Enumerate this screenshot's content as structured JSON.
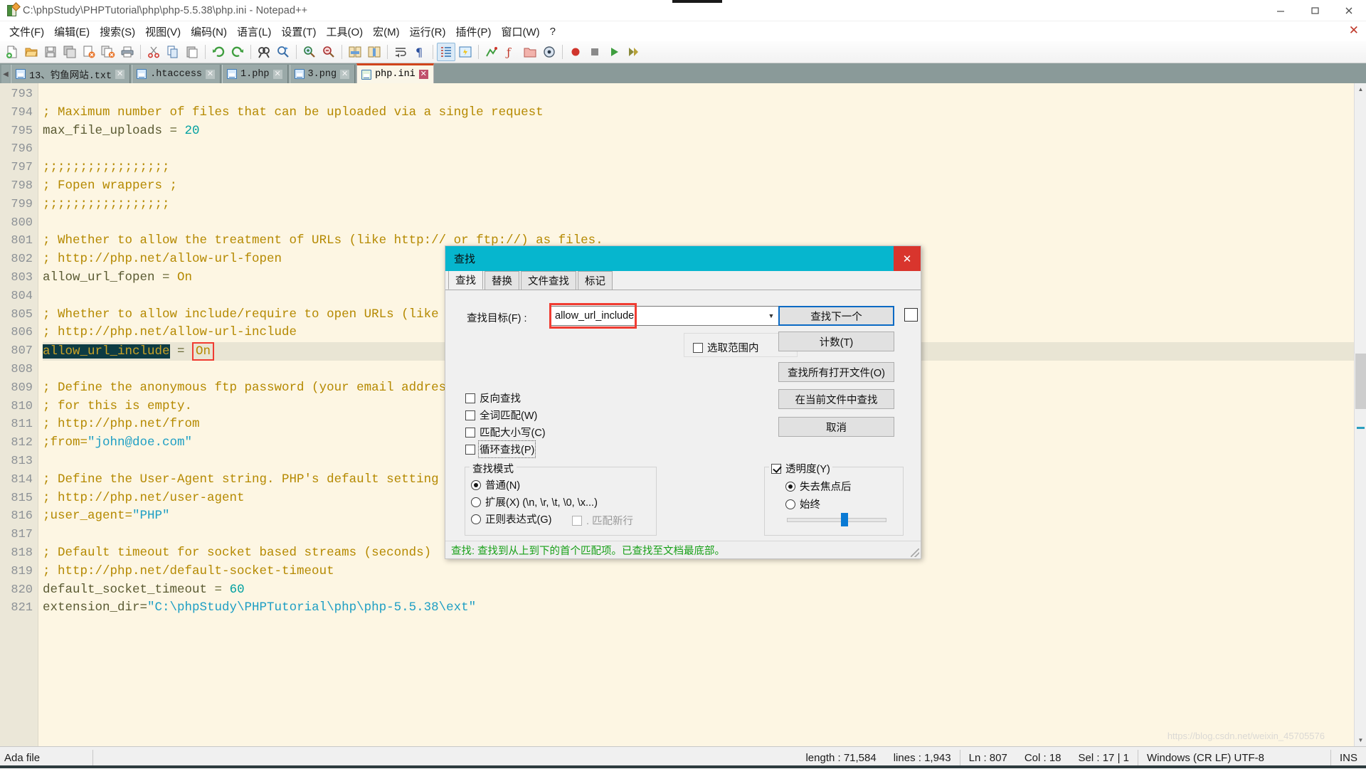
{
  "window": {
    "title": "C:\\phpStudy\\PHPTutorial\\php\\php-5.5.38\\php.ini - Notepad++",
    "icon": "notepad-plus-plus-icon",
    "minimize": "─",
    "maximize": "□",
    "close": "✕"
  },
  "menubar": {
    "items": [
      {
        "label": "文件(F)"
      },
      {
        "label": "编辑(E)"
      },
      {
        "label": "搜索(S)"
      },
      {
        "label": "视图(V)"
      },
      {
        "label": "编码(N)"
      },
      {
        "label": "语言(L)"
      },
      {
        "label": "设置(T)"
      },
      {
        "label": "工具(O)"
      },
      {
        "label": "宏(M)"
      },
      {
        "label": "运行(R)"
      },
      {
        "label": "插件(P)"
      },
      {
        "label": "窗口(W)"
      },
      {
        "label": "?"
      }
    ],
    "close_document": "✕"
  },
  "toolbar": {
    "buttons": [
      "new-file-icon",
      "open-file-icon",
      "save-icon",
      "save-all-icon",
      "close-file-icon",
      "close-all-icon",
      "print-icon",
      "cut-icon",
      "copy-icon",
      "paste-icon",
      "undo-icon",
      "redo-icon",
      "find-icon",
      "replace-icon",
      "zoom-in-icon",
      "zoom-out-icon",
      "sync-scroll-v-icon",
      "sync-scroll-h-icon",
      "word-wrap-icon",
      "show-all-chars-icon",
      "indent-guide-icon",
      "show-ui-icon",
      "record-macro-icon",
      "stop-macro-icon",
      "play-macro-icon",
      "run-macro-multiple-icon"
    ]
  },
  "tabs": {
    "scroll_left": "◀",
    "items": [
      {
        "label": "13、钓鱼网站.txt",
        "active": false,
        "close": "✕"
      },
      {
        "label": ".htaccess",
        "active": false,
        "close": "✕"
      },
      {
        "label": "1.php",
        "active": false,
        "close": "✕"
      },
      {
        "label": "3.png",
        "active": false,
        "close": "✕"
      },
      {
        "label": "php.ini",
        "active": true,
        "close": "✕"
      }
    ]
  },
  "editor": {
    "first_line": 793,
    "current_line": 807,
    "lines": [
      {
        "n": 793,
        "tokens": []
      },
      {
        "n": 794,
        "tokens": [
          {
            "t": "; Maximum number of files that can be uploaded via a single request",
            "c": "c-comment"
          }
        ]
      },
      {
        "n": 795,
        "tokens": [
          {
            "t": "max_file_uploads ",
            "c": "c-plain"
          },
          {
            "t": "= ",
            "c": "c-op"
          },
          {
            "t": "20",
            "c": "c-num"
          }
        ]
      },
      {
        "n": 796,
        "tokens": []
      },
      {
        "n": 797,
        "tokens": [
          {
            "t": ";;;;;;;;;;;;;;;;;",
            "c": "c-comment"
          }
        ]
      },
      {
        "n": 798,
        "tokens": [
          {
            "t": "; Fopen wrappers ;",
            "c": "c-comment"
          }
        ]
      },
      {
        "n": 799,
        "tokens": [
          {
            "t": ";;;;;;;;;;;;;;;;;",
            "c": "c-comment"
          }
        ]
      },
      {
        "n": 800,
        "tokens": []
      },
      {
        "n": 801,
        "tokens": [
          {
            "t": "; Whether to allow the treatment of URLs (like http:// or ftp://) as files.",
            "c": "c-comment"
          }
        ]
      },
      {
        "n": 802,
        "tokens": [
          {
            "t": "; http://php.net/allow-url-fopen",
            "c": "c-comment"
          }
        ]
      },
      {
        "n": 803,
        "tokens": [
          {
            "t": "allow_url_fopen ",
            "c": "c-plain"
          },
          {
            "t": "= ",
            "c": "c-op"
          },
          {
            "t": "On",
            "c": "c-comment"
          }
        ]
      },
      {
        "n": 804,
        "tokens": []
      },
      {
        "n": 805,
        "tokens": [
          {
            "t": "; Whether to allow include/require to open URLs (like http:// or ftp://) as files.",
            "c": "c-comment"
          }
        ]
      },
      {
        "n": 806,
        "tokens": [
          {
            "t": "; http://php.net/allow-url-include",
            "c": "c-comment"
          }
        ]
      },
      {
        "n": 807,
        "tokens": [
          {
            "t": "allow_url_include",
            "c": "c-sel"
          },
          {
            "t": " = ",
            "c": "c-op"
          },
          {
            "t": "On",
            "c": "c-comment redbox"
          }
        ]
      },
      {
        "n": 808,
        "tokens": []
      },
      {
        "n": 809,
        "tokens": [
          {
            "t": "; Define the anonymous ftp password (your email address). PHP's default setting",
            "c": "c-comment"
          }
        ]
      },
      {
        "n": 810,
        "tokens": [
          {
            "t": "; for this is empty.",
            "c": "c-comment"
          }
        ]
      },
      {
        "n": 811,
        "tokens": [
          {
            "t": "; http://php.net/from",
            "c": "c-comment"
          }
        ]
      },
      {
        "n": 812,
        "tokens": [
          {
            "t": ";from=",
            "c": "c-comment"
          },
          {
            "t": "\"john@doe.com\"",
            "c": "c-str"
          }
        ]
      },
      {
        "n": 813,
        "tokens": []
      },
      {
        "n": 814,
        "tokens": [
          {
            "t": "; Define the User-Agent string. PHP's default setting for this is empty.",
            "c": "c-comment"
          }
        ]
      },
      {
        "n": 815,
        "tokens": [
          {
            "t": "; http://php.net/user-agent",
            "c": "c-comment"
          }
        ]
      },
      {
        "n": 816,
        "tokens": [
          {
            "t": ";user_agent=",
            "c": "c-comment"
          },
          {
            "t": "\"PHP\"",
            "c": "c-str"
          }
        ]
      },
      {
        "n": 817,
        "tokens": []
      },
      {
        "n": 818,
        "tokens": [
          {
            "t": "; Default timeout for socket based streams (seconds)",
            "c": "c-comment"
          }
        ]
      },
      {
        "n": 819,
        "tokens": [
          {
            "t": "; http://php.net/default-socket-timeout",
            "c": "c-comment"
          }
        ]
      },
      {
        "n": 820,
        "tokens": [
          {
            "t": "default_socket_timeout ",
            "c": "c-plain"
          },
          {
            "t": "= ",
            "c": "c-op"
          },
          {
            "t": "60",
            "c": "c-num"
          }
        ]
      },
      {
        "n": 821,
        "tokens": [
          {
            "t": "extension_dir=",
            "c": "c-plain"
          },
          {
            "t": "\"C:\\phpStudy\\PHPTutorial\\php\\php-5.5.38\\ext\"",
            "c": "c-str"
          }
        ]
      }
    ]
  },
  "find_dialog": {
    "title": "查找",
    "close": "✕",
    "tabs": [
      {
        "label": "查找",
        "active": true
      },
      {
        "label": "替换",
        "active": false
      },
      {
        "label": "文件查找",
        "active": false
      },
      {
        "label": "标记",
        "active": false
      }
    ],
    "find_what_label": "查找目标(F) :",
    "find_what_value": "allow_url_include",
    "find_what_placeholder": "",
    "combo_arrow": "▼",
    "in_selection_label": "选取范围内",
    "in_selection_checked": false,
    "buttons": {
      "find_next": "查找下一个",
      "count": "计数(T)",
      "find_all_open": "查找所有打开文件(O)",
      "find_all_current": "在当前文件中查找",
      "cancel": "取消"
    },
    "options": [
      {
        "label": "反向查找",
        "checked": false,
        "focus": false
      },
      {
        "label": "全词匹配(W)",
        "checked": false,
        "focus": false
      },
      {
        "label": "匹配大小写(C)",
        "checked": false,
        "focus": false
      },
      {
        "label": "循环查找(P)",
        "checked": false,
        "focus": true
      }
    ],
    "search_mode_group": "查找模式",
    "search_modes": [
      {
        "label": "普通(N)",
        "selected": true
      },
      {
        "label": "扩展(X) (\\n, \\r, \\t, \\0, \\x...)",
        "selected": false
      },
      {
        "label": "正则表达式(G)",
        "selected": false
      }
    ],
    "match_newline_label": ". 匹配新行",
    "match_newline_checked": false,
    "transparency_label": "透明度(Y)",
    "transparency_checked": true,
    "transparency_modes": [
      {
        "label": "失去焦点后",
        "selected": true
      },
      {
        "label": "始终",
        "selected": false
      }
    ],
    "transparency_value": 62,
    "status": "查找: 查找到从上到下的首个匹配项。已查找至文档最底部。"
  },
  "statusbar": {
    "file_type": "Ada file",
    "length": "length : 71,584",
    "lines": "lines : 1,943",
    "ln": "Ln : 807",
    "col": "Col : 18",
    "sel": "Sel : 17 | 1",
    "encoding": "Windows (CR LF)  UTF-8",
    "insert_mode": "INS"
  },
  "watermark": "https://blog.csdn.net/weixin_45705576",
  "colors": {
    "accent_dialog_title": "#06b6ce",
    "close_button": "#d9352d",
    "editor_background": "#fdf6e3",
    "comment": "#b58900",
    "selection": "#0d3b43",
    "highlight_box": "#f03c32",
    "status_ok": "#18a018",
    "tabbar": "#8a9a99",
    "active_tab_top": "#d0441b"
  }
}
